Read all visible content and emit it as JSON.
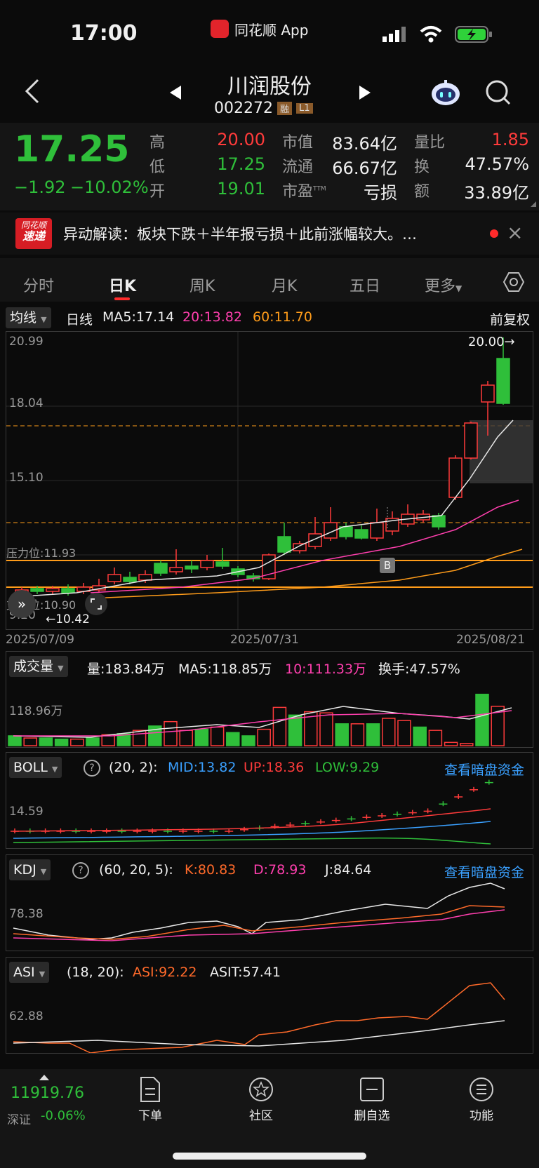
{
  "status": {
    "time": "17:00",
    "app": "同花顺 App"
  },
  "header": {
    "name": "川润股份",
    "code": "002272",
    "badge1": "融",
    "badge2": "L1"
  },
  "quote": {
    "price": "17.25",
    "change": "−1.92",
    "change_pct": "−10.02%",
    "high_label": "高",
    "high": "20.00",
    "low_label": "低",
    "low": "17.25",
    "open_label": "开",
    "open": "19.01",
    "mcap_label": "市值",
    "mcap": "83.64亿",
    "float_label": "流通",
    "float": "66.67亿",
    "pe_label": "市盈",
    "pe_sup": "TTM",
    "pe": "亏损",
    "vr_label": "量比",
    "vr": "1.85",
    "turn_label": "换",
    "turn": "47.57%",
    "amt_label": "额",
    "amt": "33.89亿"
  },
  "news": {
    "logo1": "同花顺",
    "logo2": "速递",
    "text": "异动解读：板块下跌＋半年报亏损＋此前涨幅较大。…",
    "close": "×"
  },
  "tabs": [
    {
      "label": "分时"
    },
    {
      "label": "日K"
    },
    {
      "label": "周K"
    },
    {
      "label": "月K"
    },
    {
      "label": "五日"
    },
    {
      "label": "更多"
    }
  ],
  "ma_bar": {
    "select": "均线",
    "line": "日线",
    "ma5": "MA5:17.14",
    "ma20": "20:13.82",
    "ma60": "60:11.70",
    "adjust": "前复权"
  },
  "kchart": {
    "y_labels": [
      "20.99",
      "18.04",
      "15.10",
      "9.20"
    ],
    "pressure": "压力位:11.93",
    "support": "支撑位:10.90",
    "low_mark": "←10.42",
    "high_mark": "20.00→",
    "b_mark": "B",
    "dates": [
      "2025/07/09",
      "2025/07/31",
      "2025/08/21"
    ]
  },
  "volume": {
    "select": "成交量",
    "vol": "量:183.84万",
    "ma5": "MA5:118.85万",
    "ma10": "10:111.33万",
    "turn": "换手:47.57%",
    "y_label": "118.96万"
  },
  "boll": {
    "select": "BOLL",
    "params": "(20, 2):",
    "mid": "MID:13.82",
    "up": "UP:18.36",
    "low": "LOW:9.29",
    "link": "查看暗盘资金",
    "y_label": "14.59"
  },
  "kdj": {
    "select": "KDJ",
    "params": "(60, 20, 5):",
    "k": "K:80.83",
    "d": "D:78.93",
    "j": "J:84.64",
    "link": "查看暗盘资金",
    "y_label": "78.38"
  },
  "asi": {
    "select": "ASI",
    "params": "(18, 20):",
    "asi": "ASI:92.22",
    "asit": "ASIT:57.41",
    "y_label": "62.88"
  },
  "bottom": {
    "index_value": "11919.76",
    "index_name": "深证",
    "index_change": "-0.06%",
    "items": [
      {
        "label": "下单"
      },
      {
        "label": "社区"
      },
      {
        "label": "删自选"
      },
      {
        "label": "功能"
      }
    ]
  },
  "chart_data": {
    "type": "candlestick",
    "dates": [
      "2025/07/09",
      "2025/07/31",
      "2025/08/21"
    ],
    "last_candle": {
      "open": 19.01,
      "high": 20.0,
      "low": 17.25,
      "close": 17.25
    },
    "ma": {
      "MA5": 17.14,
      "MA20": 13.82,
      "MA60": 11.7
    },
    "ylim": [
      9.2,
      20.99
    ],
    "pressure": 11.93,
    "support": 10.9
  }
}
